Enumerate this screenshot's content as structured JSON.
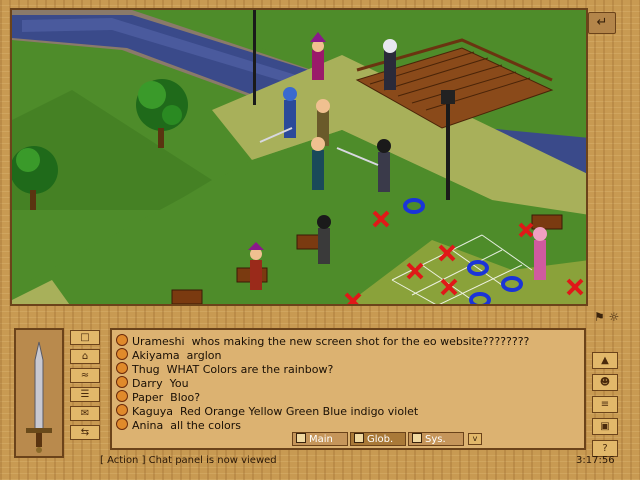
{
  "window": {
    "back_label": "↵"
  },
  "chat": {
    "lines": [
      {
        "name": "Urameshi",
        "text": "whos making the new screen shot for the eo website????????"
      },
      {
        "name": "Akiyama",
        "text": "arglon"
      },
      {
        "name": "Thug",
        "text": "WHAT Colors are the rainbow?"
      },
      {
        "name": "Darry",
        "text": "You"
      },
      {
        "name": "Paper",
        "text": "Bloo?"
      },
      {
        "name": "Kaguya",
        "text": "Red Orange Yellow Green Blue indigo violet"
      },
      {
        "name": "Anina",
        "text": "all the colors"
      }
    ]
  },
  "tabs": [
    {
      "label": "Main"
    },
    {
      "label": "Glob."
    },
    {
      "label": "Sys."
    }
  ],
  "status": {
    "message": "[ Action ] Chat panel is now viewed",
    "time": "3:17:56"
  },
  "icons": {
    "left_buttons": [
      "inventory-icon",
      "home-icon",
      "map-icon",
      "stats-icon",
      "chat-icon",
      "trade-icon"
    ],
    "right_buttons": [
      "guild-icon",
      "party-icon",
      "settings-icon",
      "options-icon",
      "help-icon"
    ],
    "status_icons": [
      "sit-icon",
      "emote-icon"
    ]
  },
  "colors": {
    "frame": "#c89a52",
    "chat_bg": "#dcb271",
    "grass": "#4e8c2a",
    "path": "#a8b05a",
    "river": "#3a4a8a",
    "red_x": "#e01818",
    "blue_ring": "#1a34d8"
  }
}
